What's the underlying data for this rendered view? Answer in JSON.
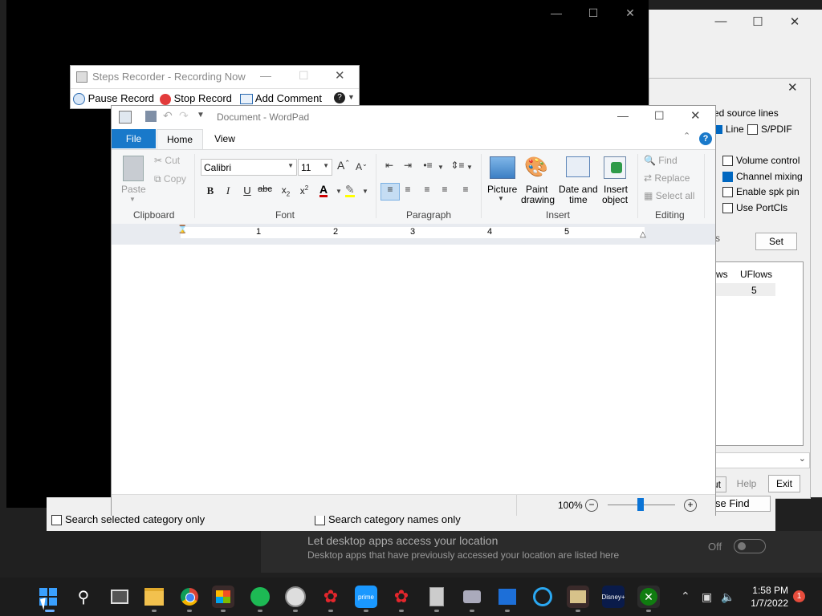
{
  "steps_recorder": {
    "title": "Steps Recorder - Recording Now",
    "pause": "Pause Record",
    "stop": "Stop Record",
    "add_comment": "Add Comment"
  },
  "wordpad": {
    "title": "Document - WordPad",
    "tabs": [
      "File",
      "Home",
      "View"
    ],
    "clipboard": {
      "paste": "Paste",
      "cut": "Cut",
      "copy": "Copy",
      "group": "Clipboard"
    },
    "font": {
      "name": "Calibri",
      "size": "11",
      "group": "Font"
    },
    "paragraph": {
      "group": "Paragraph"
    },
    "insert": {
      "picture": "Picture",
      "paint1": "Paint",
      "paint2": "drawing",
      "date1": "Date and",
      "date2": "time",
      "obj1": "Insert",
      "obj2": "object",
      "group": "Insert"
    },
    "editing": {
      "find": "Find",
      "replace": "Replace",
      "select_all": "Select all",
      "group": "Editing"
    },
    "ruler": [
      "1",
      "2",
      "3",
      "4",
      "5"
    ],
    "zoom": "100%",
    "zoom_level_pct": 100
  },
  "sound_dialog": {
    "partial_header": "ed source lines",
    "line": "Line",
    "spdif": "S/PDIF",
    "volume_control": "Volume control",
    "channel_mixing": "Channel mixing",
    "enable_spk_pin": "Enable spk pin",
    "use_portcls": "Use PortCls",
    "set": "Set",
    "col_ws": "ws",
    "col_uflows": "UFlows",
    "uflows_value": "5",
    "help": "Help",
    "exit": "Exit",
    "partial_ut": "ut",
    "s_label": "s"
  },
  "find_window": {
    "search_selected": "Search selected category only",
    "search_names": "Search category names only",
    "close_find": "se Find"
  },
  "location": {
    "heading": "Let desktop apps access your location",
    "desc": "Desktop apps that have previously accessed your location are listed here",
    "toggle": "Off"
  },
  "taskbar": {
    "time": "1:58 PM",
    "date": "1/7/2022",
    "notifications": "1"
  }
}
